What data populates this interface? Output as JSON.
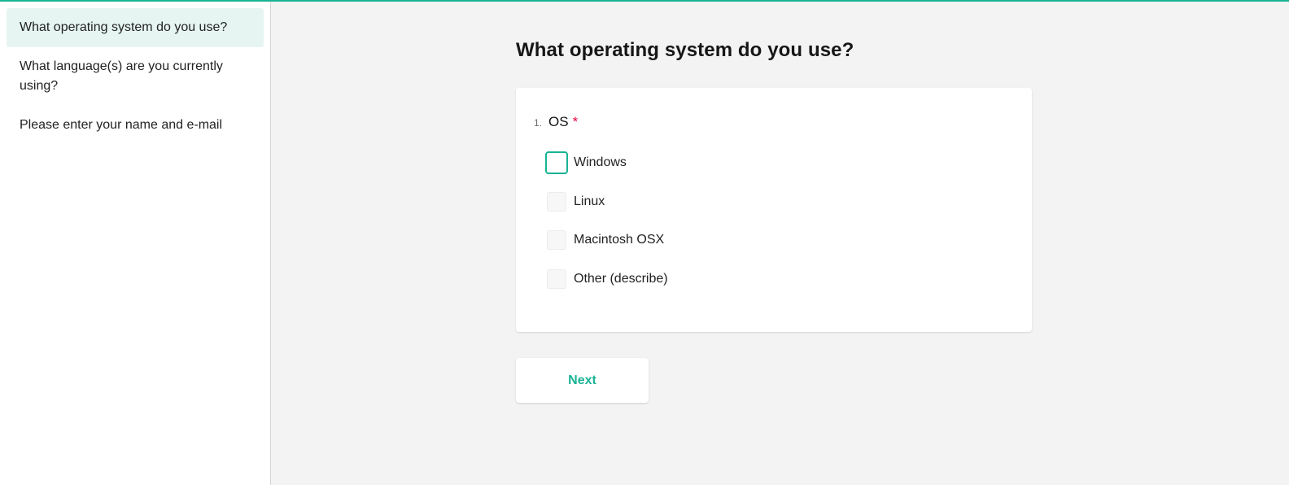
{
  "theme": {
    "accent": "#19b394",
    "required": "#e50a3e"
  },
  "sidebar": {
    "items": [
      {
        "label": "What operating system do you use?",
        "active": true
      },
      {
        "label": "What language(s) are you currently using?",
        "active": false
      },
      {
        "label": "Please enter your name and e-mail",
        "active": false
      }
    ]
  },
  "page": {
    "title": "What operating system do you use?"
  },
  "question": {
    "number": "1.",
    "title": "OS",
    "required_mark": "*",
    "choices": [
      {
        "label": "Windows",
        "checked": false,
        "focused": true
      },
      {
        "label": "Linux",
        "checked": false,
        "focused": false
      },
      {
        "label": "Macintosh OSX",
        "checked": false,
        "focused": false
      },
      {
        "label": "Other (describe)",
        "checked": false,
        "focused": false
      }
    ]
  },
  "navigation": {
    "next_label": "Next"
  }
}
